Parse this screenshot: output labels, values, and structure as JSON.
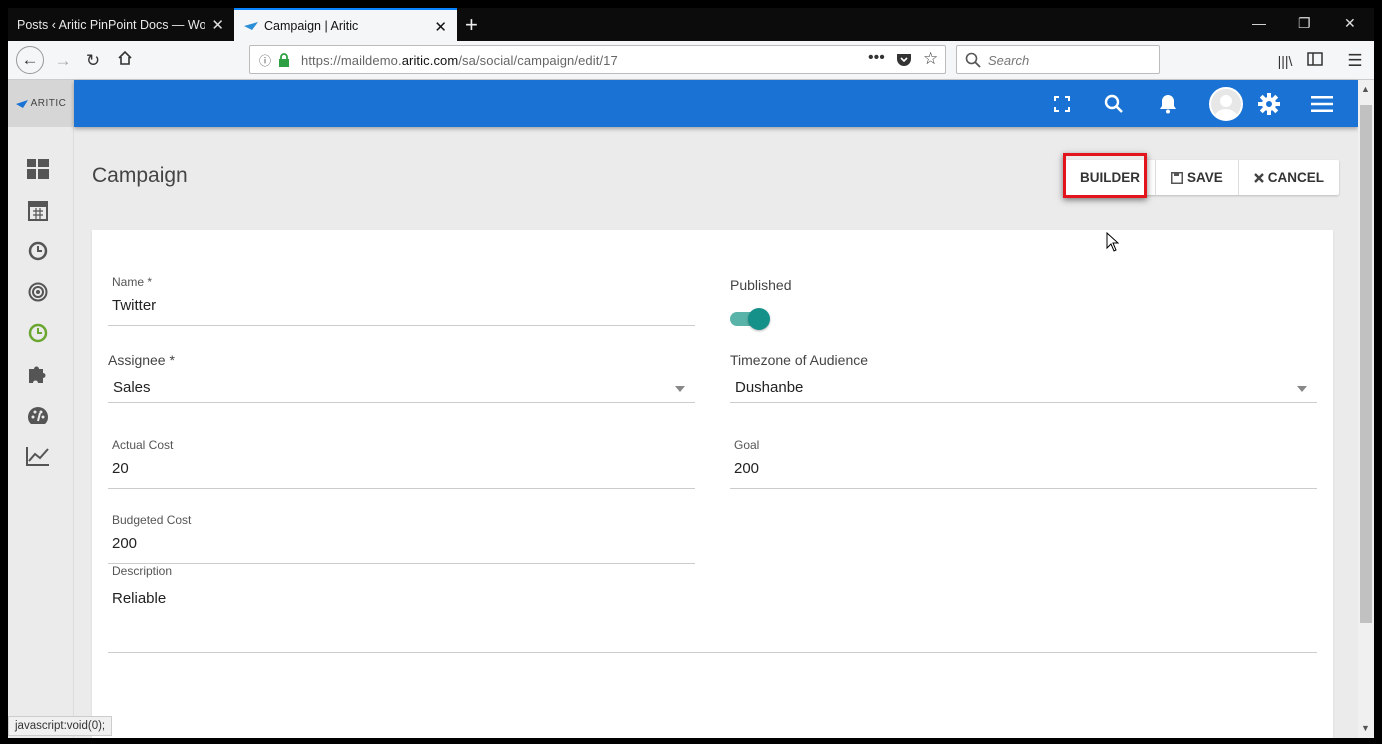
{
  "browser": {
    "tabs": [
      {
        "label": "Posts ‹ Aritic PinPoint Docs — WordPress"
      },
      {
        "label": "Campaign | Aritic"
      }
    ],
    "url": {
      "prefix": "https://maildemo.",
      "domain": "aritic.com",
      "path": "/sa/social/campaign/edit/17"
    },
    "search_placeholder": "Search",
    "status_text": "javascript:void(0);"
  },
  "app": {
    "logo_text": "ARITIC",
    "sidebar_icons": [
      "dashboard-icon",
      "calendar-icon",
      "clock-icon",
      "target-icon",
      "campaign-clock-icon",
      "puzzle-icon",
      "palette-icon",
      "chart-line-icon"
    ],
    "topbar_icons": [
      "fullscreen-icon",
      "search-icon",
      "bell-icon",
      "avatar",
      "gear-icon",
      "menu-icon"
    ],
    "accent_color": "#1a73d4"
  },
  "page": {
    "title": "Campaign",
    "buttons": {
      "builder": "BUILDER",
      "save": "SAVE",
      "cancel": "CANCEL"
    }
  },
  "form": {
    "name": {
      "label": "Name *",
      "value": "Twitter"
    },
    "published": {
      "label": "Published",
      "value": true
    },
    "assignee": {
      "label": "Assignee *",
      "value": "Sales"
    },
    "timezone": {
      "label": "Timezone of Audience",
      "value": "Dushanbe"
    },
    "actual_cost": {
      "label": "Actual Cost",
      "value": "20"
    },
    "goal": {
      "label": "Goal",
      "value": "200"
    },
    "budgeted_cost": {
      "label": "Budgeted Cost",
      "value": "200"
    },
    "description": {
      "label": "Description",
      "value": "Reliable"
    }
  }
}
